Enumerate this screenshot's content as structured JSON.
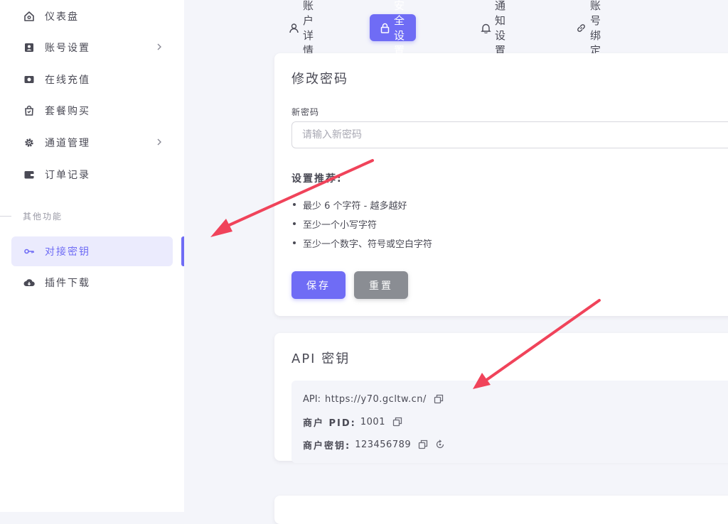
{
  "sidebar": {
    "items": [
      {
        "label": "仪表盘",
        "icon": "home-icon"
      },
      {
        "label": "账号设置",
        "icon": "account-icon",
        "has_submenu": true
      },
      {
        "label": "在线充值",
        "icon": "recharge-icon"
      },
      {
        "label": "套餐购买",
        "icon": "shopping-bag-icon"
      },
      {
        "label": "通道管理",
        "icon": "gear-icon",
        "has_submenu": true
      },
      {
        "label": "订单记录",
        "icon": "wallet-icon"
      }
    ],
    "section_label": "其他功能",
    "extra_items": [
      {
        "label": "对接密钥",
        "icon": "key-icon",
        "active": true
      },
      {
        "label": "插件下载",
        "icon": "cloud-download-icon"
      }
    ]
  },
  "tabs": [
    {
      "label": "账户详情",
      "icon": "user-icon"
    },
    {
      "label": "安全设置",
      "icon": "lock-icon",
      "active": true
    },
    {
      "label": "通知设置",
      "icon": "bell-icon"
    },
    {
      "label": "账号绑定",
      "icon": "link-icon"
    }
  ],
  "password_card": {
    "title": "修改密码",
    "field_label": "新密码",
    "placeholder": "请输入新密码",
    "recommend_title": "设置推荐:",
    "recommendations": [
      "最少 6 个字符 - 越多越好",
      "至少一个小写字符",
      "至少一个数字、符号或空白字符"
    ],
    "save_label": "保存",
    "reset_label": "重置"
  },
  "api_card": {
    "title": "API 密钥",
    "rows": [
      {
        "label": "API:",
        "value": "https://y70.gcltw.cn/"
      },
      {
        "label": "商户 PID:",
        "value": "1001"
      },
      {
        "label": "商户密钥:",
        "value": "123456789"
      }
    ]
  },
  "colors": {
    "accent": "#6f6cf5",
    "reset": "#8a8d93",
    "arrow": "#f0435a",
    "background": "#f4f5fa"
  }
}
